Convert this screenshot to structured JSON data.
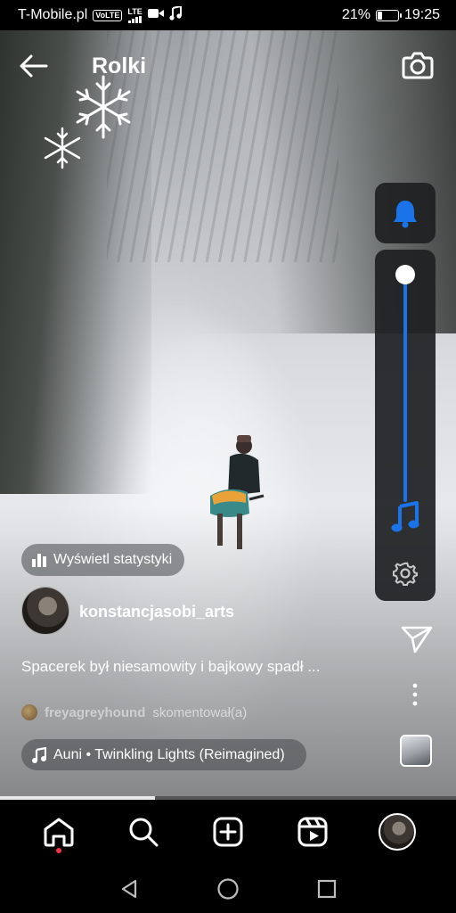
{
  "status_bar": {
    "carrier": "T-Mobile.pl",
    "volte_badge": "VoLTE",
    "lte_label": "LTE",
    "battery_percent": "21%",
    "battery_level": 0.21,
    "time": "19:25"
  },
  "header": {
    "title": "Rolki",
    "back_icon": "arrow-left-icon",
    "camera_icon": "camera-icon"
  },
  "volume_panel": {
    "ringer_icon": "bell-icon",
    "level": 0.95,
    "music_icon": "music-note-icon",
    "settings_icon": "gear-icon",
    "accent": "#1a73e8"
  },
  "post": {
    "stats_button": "Wyświetl statystyki",
    "username": "konstancjasobi_arts",
    "caption": "Spacerek był niesamowity i bajkowy spadł ...",
    "comment_user": "freyagreyhound",
    "comment_action": "skomentował(a)",
    "audio": "Auni • Twinkling Lights (Reimagined)",
    "progress": 0.34
  },
  "side_actions": {
    "share_icon": "send-icon",
    "more_icon": "more-vertical-icon",
    "audio_thumb": "audio-thumbnail"
  },
  "bottom_nav": {
    "items": [
      "home-icon",
      "search-icon",
      "create-icon",
      "reels-icon",
      "profile-avatar"
    ],
    "notification_color": "#ff3040"
  },
  "system_nav": [
    "back-triangle-icon",
    "home-circle-icon",
    "recents-square-icon"
  ]
}
